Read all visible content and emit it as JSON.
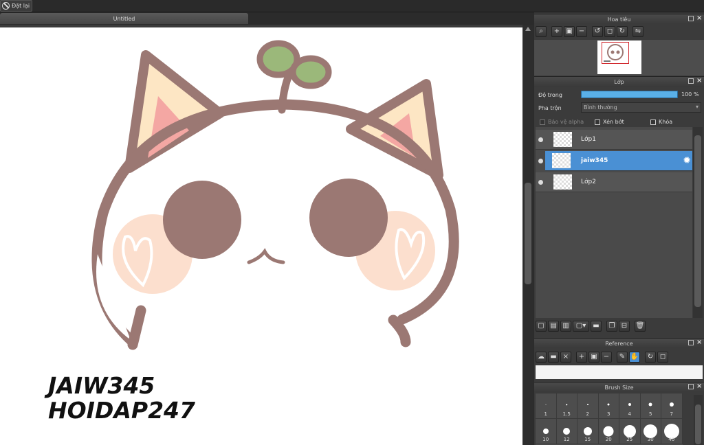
{
  "toolbar": {
    "reset_label": "Đặt lại"
  },
  "document": {
    "tab_title": "Untitled"
  },
  "canvas": {
    "caption_line1": "JAIW345",
    "caption_line2": "HOIDAP247"
  },
  "navigator": {
    "title": "Hoa tiêu"
  },
  "layers_panel": {
    "title": "Lớp",
    "opacity_label": "Độ trong",
    "opacity_value": "100 %",
    "opacity_fraction": 1.0,
    "blend_label": "Pha trộn",
    "blend_value": "Bình thường",
    "protect_alpha_label": "Bảo vệ alpha",
    "clipping_label": "Xén bớt",
    "lock_label": "Khóa",
    "layers": [
      {
        "name": "Lớp1",
        "selected": false
      },
      {
        "name": "jaiw345",
        "selected": true
      },
      {
        "name": "Lớp2",
        "selected": false
      }
    ]
  },
  "reference": {
    "title": "Reference"
  },
  "brush_size": {
    "title": "Brush Size",
    "sizes": [
      "1",
      "1.5",
      "2",
      "3",
      "4",
      "5",
      "7",
      "10",
      "12",
      "15",
      "20",
      "25",
      "30",
      "40"
    ]
  },
  "colors": {
    "accent": "#4a90d4",
    "cat_outline": "#9b7873",
    "ear_inner": "#f4a7a3",
    "ear_outer": "#fde6c4",
    "blush": "#fcd2b9",
    "leaf": "#9bb87a"
  }
}
